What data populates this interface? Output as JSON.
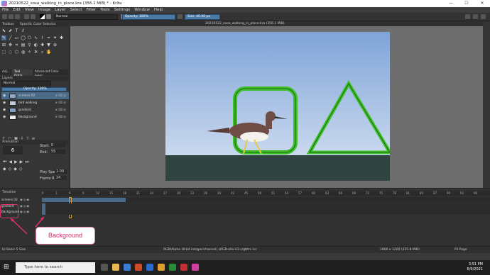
{
  "window": {
    "title": "20210522_sosa_walking_in_place.kra (356.1 MiB) * - Krita",
    "buttons": [
      "—",
      "☐",
      "✕"
    ]
  },
  "menu": [
    "File",
    "Edit",
    "View",
    "Image",
    "Layer",
    "Select",
    "Filter",
    "Tools",
    "Settings",
    "Window",
    "Help"
  ],
  "toolbar": {
    "blend_mode": "Normal",
    "opacity_label": "Opacity: 100%",
    "size_label": "Size: 40.00 px"
  },
  "toolbox": {
    "title": "Toolbox",
    "secondary_title": "Specific Color Selector"
  },
  "dockers": {
    "tabs": [
      "Adj...",
      "Tool Optio...",
      "Advanced Color Selec..."
    ],
    "layers_title": "Layers",
    "layer_blend": "Normal",
    "layer_opacity": "Opacity: 100%",
    "layers": [
      {
        "name": "screens 02",
        "selected": true
      },
      {
        "name": "bird walking",
        "selected": false
      },
      {
        "name": "gradient",
        "selected": false
      },
      {
        "name": "Background",
        "selected": false
      }
    ],
    "animation_title": "Animation",
    "current_frame": "6",
    "start_label": "Start:",
    "start_value": "0",
    "end_label": "End:",
    "end_value": "55",
    "play_speed_label": "Play Speed:",
    "play_speed_value": "1.00",
    "frame_rate_label": "Frame Rate:",
    "frame_rate_value": "24"
  },
  "document": {
    "tab_title": "20210522_sosa_walking_in_place.kra (356.1 MiB)"
  },
  "timeline": {
    "title": "Timeline",
    "ruler": [
      "0",
      "3",
      "6",
      "9",
      "12",
      "15",
      "18",
      "21",
      "24",
      "27",
      "30",
      "33",
      "36",
      "39",
      "42",
      "45",
      "48",
      "51",
      "54",
      "57",
      "60",
      "63",
      "66",
      "69",
      "72",
      "75",
      "78",
      "81",
      "84",
      "87",
      "90",
      "93",
      "96"
    ],
    "rows": [
      "screens 02",
      "gradient",
      "Background"
    ]
  },
  "status": {
    "brush": "b) Basic-5 Size",
    "color_space": "RGB/Alpha (8-bit integer/channel)  sRGB-elle-V2-srgbtrc.icc",
    "dimensions": "1800 x 1200 (335.8 MiB)",
    "zoom": "Fit Page"
  },
  "taskbar": {
    "search_placeholder": "Type here to search",
    "time": "3:51 PM",
    "date": "6/9/2021"
  },
  "annotation": {
    "callout": "Background"
  },
  "colors": {
    "sky_top": "#7fa4d8",
    "sky_bottom": "#c9d8ee",
    "ground": "#2f4440",
    "green_shape": "#3fbf2a",
    "selection": "#4a6a8a",
    "highlight": "#e0306e"
  }
}
